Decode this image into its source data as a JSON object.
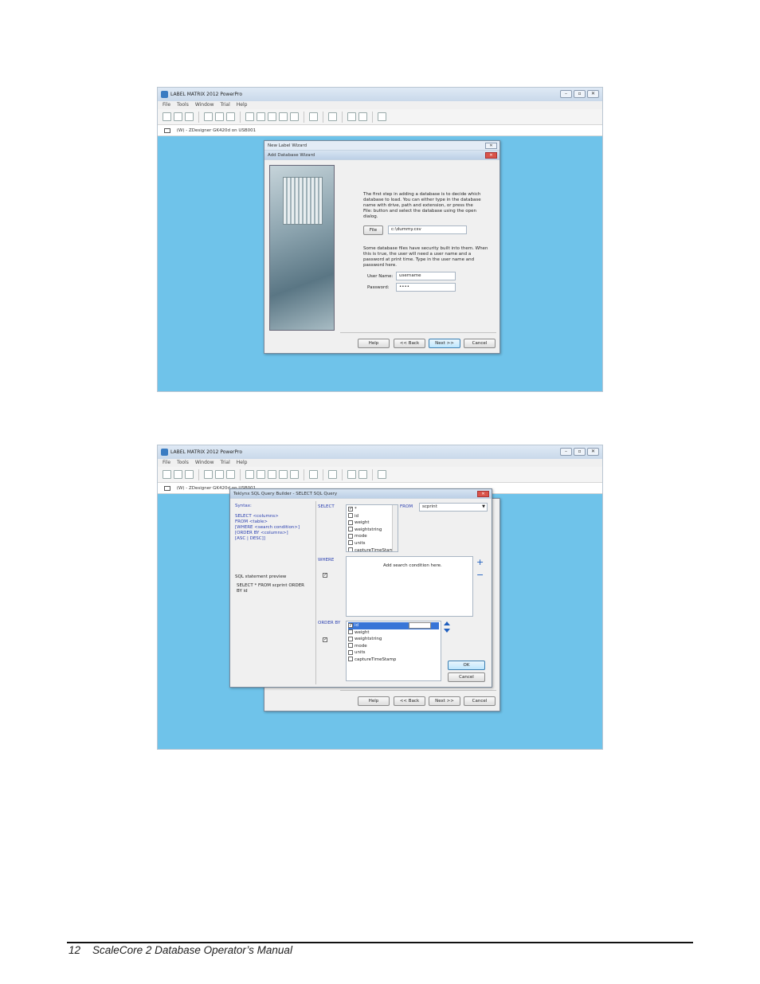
{
  "app": {
    "title": "LABEL MATRIX 2012 PowerPro",
    "menu": [
      "File",
      "Tools",
      "Window",
      "Trial",
      "Help"
    ],
    "printer": "(W) - ZDesigner GK420d on USB001",
    "printer_truncated": "(W) - ZDesigner GK420d on USB001",
    "window_controls": [
      "minimize-icon",
      "maximize-icon",
      "close-icon"
    ]
  },
  "wizard": {
    "outer_title": "New Label Wizard",
    "inner_title": "Add Database Wizard",
    "intro": "The first step in adding a database is to decide which database to load. You can either type in the database name with drive, path and extension, or press the File: button and select the database using the open dialog.",
    "file_button": "File",
    "file_path": "c:\\dummy.csv",
    "security_text": "Some database files have security built into them. When this is true, the user will need a user name and a password at print time. Type in the user name and password here.",
    "username_label": "User Name:",
    "username_value": "username",
    "password_label": "Password:",
    "password_value": "••••",
    "buttons": {
      "help": "Help",
      "back": "<< Back",
      "next": "Next >>",
      "cancel": "Cancel"
    }
  },
  "sql_builder": {
    "title": "Teklynx SQL Query Builder - SELECT SQL Query",
    "syntax_label": "Syntax:",
    "syntax_lines": [
      "SELECT <columns>",
      "FROM <table>",
      "[WHERE <search condition>]",
      "[ORDER BY <columns>]",
      "[ASC | DESC]]"
    ],
    "preview_label": "SQL statement preview",
    "preview_text": "SELECT * FROM scprint ORDER BY id",
    "select_label": "SELECT",
    "select_items": [
      {
        "label": "*",
        "checked": true
      },
      {
        "label": "id",
        "checked": false
      },
      {
        "label": "weight",
        "checked": false
      },
      {
        "label": "weightstring",
        "checked": false
      },
      {
        "label": "mode",
        "checked": false
      },
      {
        "label": "units",
        "checked": false
      },
      {
        "label": "captureTimeStamp",
        "checked": false
      }
    ],
    "from_label": "FROM",
    "from_value": "scprint",
    "where_label": "WHERE",
    "where_placeholder": "Add search condition here.",
    "order_label": "ORDER BY",
    "order_items": [
      {
        "label": "id",
        "checked": true
      },
      {
        "label": "weight",
        "checked": false
      },
      {
        "label": "weightstring",
        "checked": false
      },
      {
        "label": "mode",
        "checked": false
      },
      {
        "label": "units",
        "checked": false
      },
      {
        "label": "captureTimeStamp",
        "checked": false
      }
    ],
    "add_symbol": "+",
    "remove_symbol": "−",
    "ok": "OK",
    "cancel": "Cancel"
  },
  "footer": {
    "page_number": "12",
    "manual_title": "ScaleCore 2 Database Operator’s Manual"
  }
}
